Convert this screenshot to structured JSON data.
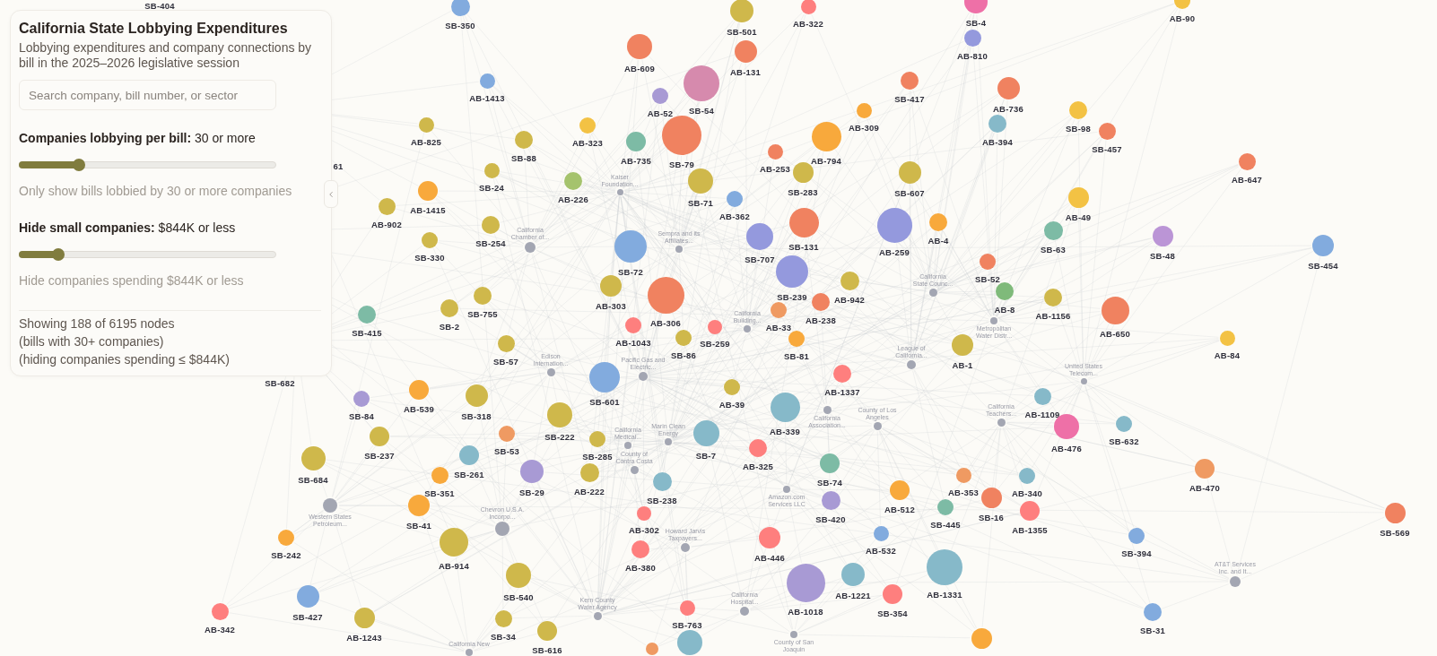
{
  "panel": {
    "title": "California State Lobbying Expenditures",
    "subtitle": "Lobbying expenditures and company connections by bill in the 2025–2026 legislative session",
    "search": {
      "placeholder": "Search company, bill number, or sector"
    },
    "filters": [
      {
        "label": "**Companies lobbying per bill:** 30 or more",
        "level": 0.233,
        "hint": "Only show bills lobbied by 30 or more companies"
      },
      {
        "label": "**Hide small companies:** $844K or less",
        "level": 0.153,
        "hint": "Hide companies spending $844K or less"
      }
    ],
    "summary": [
      "Showing 188 of 6195 nodes",
      "(bills with 30+ companies)",
      "(hiding companies spending ≤ $844K)"
    ]
  },
  "graph": {
    "bills": [
      {
        "label": "SB-404"
      },
      {
        "label": "SB-350",
        "color": "#82abde"
      },
      {
        "label": "AB-322",
        "color": "#fe7f7e"
      },
      {
        "label": "SB-4",
        "color": "#ee70a7"
      },
      {
        "label": "AB-90",
        "color": "#f3c244"
      },
      {
        "label": "SB-501",
        "color": "#cfb84b"
      },
      {
        "label": "AB-810",
        "color": "#9499dd"
      },
      {
        "label": "AB-609",
        "color": "#f08260"
      },
      {
        "label": "AB-131",
        "color": "#f08260"
      },
      {
        "label": "AB-1413",
        "color": "#82abde"
      },
      {
        "label": "SB-417",
        "color": "#f08260"
      },
      {
        "label": "AB-52",
        "color": "#a89ad4"
      },
      {
        "label": "SB-54",
        "color": "#d68aad"
      },
      {
        "label": "AB-736",
        "color": "#f08260"
      },
      {
        "label": "AB-309",
        "color": "#f8a93c"
      },
      {
        "label": "SB-98",
        "color": "#f3c244"
      },
      {
        "label": "AB-825",
        "color": "#cfb84b"
      },
      {
        "label": "AB-323",
        "color": "#f3c244"
      },
      {
        "label": "AB-394",
        "color": "#86b9c9"
      },
      {
        "label": "SB-457",
        "color": "#f08260"
      },
      {
        "label": "61"
      },
      {
        "label": "SB-88",
        "color": "#cfb84b"
      },
      {
        "label": "AB-735",
        "color": "#7dbba5"
      },
      {
        "label": "SB-79",
        "color": "#f08260"
      },
      {
        "label": "AB-253",
        "color": "#f08260"
      },
      {
        "label": "AB-794",
        "color": "#f8a93c"
      },
      {
        "label": "AB-647",
        "color": "#f08260"
      },
      {
        "label": "SB-24",
        "color": "#cfb84b"
      },
      {
        "label": "AB-226",
        "color": "#a5c36d"
      },
      {
        "label": "SB-71",
        "color": "#cfb84b"
      },
      {
        "label": "SB-283",
        "color": "#cfb84b"
      },
      {
        "label": "SB-607",
        "color": "#cfb84b"
      },
      {
        "label": "AB-902",
        "color": "#cfb84b"
      },
      {
        "label": "AB-1415",
        "color": "#f8a93c"
      },
      {
        "label": "AB-362",
        "color": "#82abde"
      },
      {
        "label": "AB-49",
        "color": "#f3c244"
      },
      {
        "label": "SB-254",
        "color": "#cfb84b"
      },
      {
        "label": "SB-131",
        "color": "#f08260"
      },
      {
        "label": "AB-4",
        "color": "#f8a93c"
      },
      {
        "label": "SB-330",
        "color": "#cfb84b"
      },
      {
        "label": "SB-707",
        "color": "#9499dd"
      },
      {
        "label": "AB-259",
        "color": "#9499dd"
      },
      {
        "label": "SB-63",
        "color": "#7dbba5"
      },
      {
        "label": "SB-48",
        "color": "#bb95d6"
      },
      {
        "label": "SB-72",
        "color": "#82abde"
      },
      {
        "label": "SB-454",
        "color": "#82abde"
      },
      {
        "label": "SB-52",
        "color": "#f08260"
      },
      {
        "label": "AB-303",
        "color": "#cfb84b"
      },
      {
        "label": "SB-239",
        "color": "#9499dd"
      },
      {
        "label": "AB-942",
        "color": "#cfb84b"
      },
      {
        "label": "SB-755",
        "color": "#cfb84b"
      },
      {
        "label": "AB-306",
        "color": "#f08260"
      },
      {
        "label": "AB-238",
        "color": "#f08260"
      },
      {
        "label": "AB-8",
        "color": "#7fba7a"
      },
      {
        "label": "AB-1156",
        "color": "#cfb84b"
      },
      {
        "label": "SB-415",
        "color": "#7dbba5"
      },
      {
        "label": "SB-2",
        "color": "#cfb84b"
      },
      {
        "label": "AB-33",
        "color": "#ef9a62"
      },
      {
        "label": "AB-650",
        "color": "#f08260"
      },
      {
        "label": "AB-1043",
        "color": "#fe7f7e"
      },
      {
        "label": "SB-259",
        "color": "#fe7f7e"
      },
      {
        "label": "SB-57",
        "color": "#cfb84b"
      },
      {
        "label": "SB-86",
        "color": "#cfb84b"
      },
      {
        "label": "SB-81",
        "color": "#f8a93c"
      },
      {
        "label": "AB-1",
        "color": "#cfb84b"
      },
      {
        "label": "AB-84",
        "color": "#f3c244"
      },
      {
        "label": "SB-682"
      },
      {
        "label": "AB-1337",
        "color": "#fe7f7e"
      },
      {
        "label": "SB-601",
        "color": "#82abde"
      },
      {
        "label": "AB-39",
        "color": "#cfb84b"
      },
      {
        "label": "SB-84",
        "color": "#a89ad4"
      },
      {
        "label": "AB-539",
        "color": "#f8a93c"
      },
      {
        "label": "SB-318",
        "color": "#cfb84b"
      },
      {
        "label": "AB-1109",
        "color": "#86b9c9"
      },
      {
        "label": "SB-222",
        "color": "#cfb84b"
      },
      {
        "label": "AB-339",
        "color": "#86b9c9"
      },
      {
        "label": "AB-476",
        "color": "#ee70a7"
      },
      {
        "label": "SB-632",
        "color": "#86b9c9"
      },
      {
        "label": "SB-237",
        "color": "#cfb84b"
      },
      {
        "label": "SB-53",
        "color": "#ef9a62"
      },
      {
        "label": "SB-285",
        "color": "#cfb84b"
      },
      {
        "label": "SB-7",
        "color": "#86b9c9"
      },
      {
        "label": "AB-325",
        "color": "#fe7f7e"
      },
      {
        "label": "SB-684",
        "color": "#cfb84b"
      },
      {
        "label": "SB-261",
        "color": "#86b9c9"
      },
      {
        "label": "SB-74",
        "color": "#7dbba5"
      },
      {
        "label": "SB-351",
        "color": "#f8a93c"
      },
      {
        "label": "SB-29",
        "color": "#a89ad4"
      },
      {
        "label": "AB-222",
        "color": "#cfb84b"
      },
      {
        "label": "AB-353",
        "color": "#ef9a62"
      },
      {
        "label": "AB-340",
        "color": "#86b9c9"
      },
      {
        "label": "AB-470",
        "color": "#ef9a62"
      },
      {
        "label": "SB-238",
        "color": "#86b9c9"
      },
      {
        "label": "AB-512",
        "color": "#f8a93c"
      },
      {
        "label": "SB-420",
        "color": "#a89ad4"
      },
      {
        "label": "SB-16",
        "color": "#f08260"
      },
      {
        "label": "SB-41",
        "color": "#f8a93c"
      },
      {
        "label": "AB-302",
        "color": "#fe7f7e"
      },
      {
        "label": "SB-445",
        "color": "#7dbba5"
      },
      {
        "label": "AB-1355",
        "color": "#fe7f7e"
      },
      {
        "label": "SB-569",
        "color": "#f08260"
      },
      {
        "label": "SB-242",
        "color": "#f8a93c"
      },
      {
        "label": "AB-446",
        "color": "#fe7f7e"
      },
      {
        "label": "AB-532",
        "color": "#82abde"
      },
      {
        "label": "SB-394",
        "color": "#82abde"
      },
      {
        "label": "AB-914",
        "color": "#cfb84b"
      },
      {
        "label": "AB-380",
        "color": "#fe7f7e"
      },
      {
        "label": "SB-540",
        "color": "#cfb84b"
      },
      {
        "label": "AB-1221",
        "color": "#86b9c9"
      },
      {
        "label": "AB-1331",
        "color": "#86b9c9"
      },
      {
        "label": "SB-427",
        "color": "#82abde"
      },
      {
        "label": "AB-1018",
        "color": "#a89ad4"
      },
      {
        "label": "SB-354",
        "color": "#fe7f7e"
      },
      {
        "label": "AB-342",
        "color": "#fe7f7e"
      },
      {
        "label": "AB-1243",
        "color": "#cfb84b"
      },
      {
        "label": "SB-34",
        "color": "#cfb84b"
      },
      {
        "label": "SB-763",
        "color": "#fe7f7e"
      },
      {
        "label": "SB-31",
        "color": "#82abde"
      },
      {
        "label": "SB-616",
        "color": "#cfb84b"
      },
      {
        "color": "#ef9a62"
      },
      {
        "color": "#86b9c9"
      },
      {
        "color": "#f8a93c"
      }
    ],
    "companies": [
      {
        "lines": [
          "Kaiser",
          "Foundation..."
        ]
      },
      {
        "lines": [
          "California",
          "Chamber of..."
        ]
      },
      {
        "lines": [
          "Sempra and its",
          "Affiliates..."
        ]
      },
      {
        "lines": [
          "California",
          "State Counc..."
        ]
      },
      {
        "lines": [
          "California",
          "Building..."
        ]
      },
      {
        "lines": [
          "Metropolitan",
          "Water Distr..."
        ]
      },
      {
        "lines": [
          "Edison",
          "Internation..."
        ]
      },
      {
        "lines": [
          "Pacific Gas and",
          "Electric..."
        ]
      },
      {
        "lines": [
          "League of",
          "California..."
        ]
      },
      {
        "lines": [
          "United States",
          "Telecom..."
        ]
      },
      {
        "lines": [
          "California",
          "Association..."
        ]
      },
      {
        "lines": [
          "County of Los",
          "Angeles"
        ]
      },
      {
        "lines": [
          "California",
          "Teachers..."
        ]
      },
      {
        "lines": [
          "California",
          "Medical..."
        ]
      },
      {
        "lines": [
          "Marin Clean",
          "Energy"
        ]
      },
      {
        "lines": [
          "County of",
          "Contra Costa"
        ]
      },
      {
        "lines": [
          "Amazon.com",
          "Services LLC"
        ]
      },
      {
        "lines": [
          "Western States",
          "Petroleum..."
        ]
      },
      {
        "lines": [
          "Chevron U.S.A.",
          "Incorpo..."
        ]
      },
      {
        "lines": [
          "Howard Jarvis",
          "Taxpayers..."
        ]
      },
      {
        "lines": [
          "AT&T Services",
          "Inc. and It..."
        ]
      },
      {
        "lines": [
          "Kern County",
          "Water Agency"
        ]
      },
      {
        "lines": [
          "California",
          "Hospital..."
        ]
      },
      {
        "lines": [
          "California New"
        ]
      },
      {
        "lines": [
          "County of San",
          "Joaquin"
        ]
      }
    ]
  }
}
